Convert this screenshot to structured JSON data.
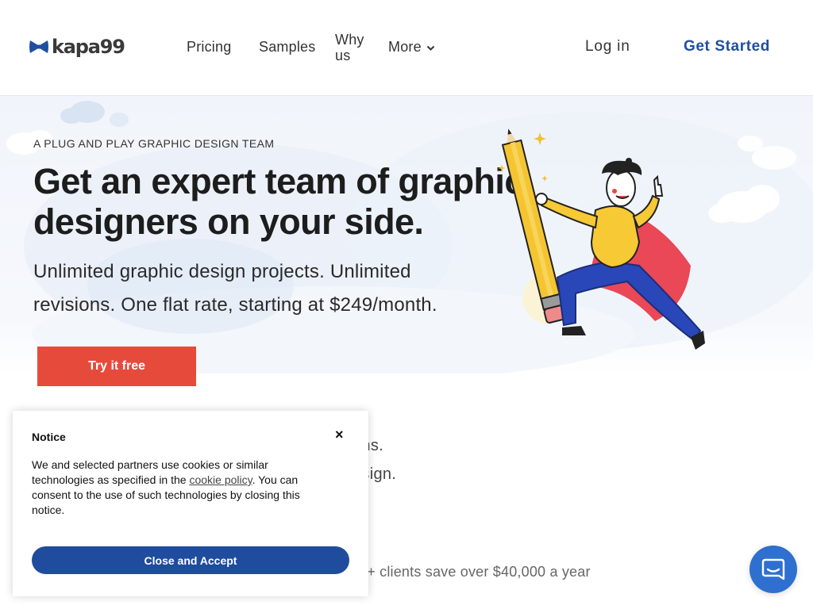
{
  "header": {
    "logo_text": "kapa99",
    "nav": {
      "pricing": "Pricing",
      "samples": "Samples",
      "why_us": "Why us",
      "more": "More"
    },
    "login": "Log in",
    "get_started": "Get Started"
  },
  "hero": {
    "eyebrow": "A PLUG AND PLAY GRAPHIC DESIGN TEAM",
    "headline": "Get an expert team of graphic designers on your side.",
    "subline": "Unlimited graphic design projects. Unlimited revisions. One flat rate, starting at $249/month.",
    "cta": "Try it free"
  },
  "partial_content": {
    "fragment_1": "ons.",
    "fragment_2": "esign.",
    "clients_line": "0+ clients save over $40,000 a year"
  },
  "cookie_notice": {
    "title": "Notice",
    "close": "×",
    "body_before_link": "We and selected partners use cookies or similar technologies as specified in the ",
    "link": "cookie policy",
    "body_after_link": ". You can consent to the use of such technologies by closing this notice.",
    "accept": "Close and Accept"
  },
  "colors": {
    "brand_blue": "#1f4fa0",
    "cta_red": "#e64a3b",
    "accept_blue": "#1f4c9c",
    "chat_blue": "#2f6fd0"
  },
  "icons": {
    "logo": "bowtie-icon",
    "more": "chevron-down-icon",
    "chat": "chat-bubble-icon"
  }
}
